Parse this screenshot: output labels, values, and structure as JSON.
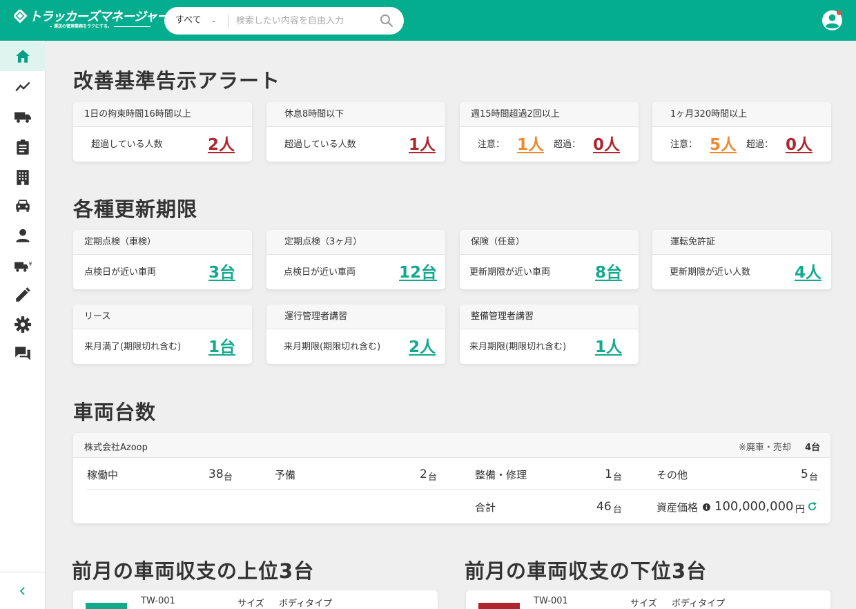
{
  "header": {
    "logo_title": "トラッカーズマネージャー",
    "logo_tagline": "運送の管理業務をラクにする。",
    "search_scope": "すべて",
    "search_placeholder": "検索したい内容を自由入力"
  },
  "sidebar": {
    "items": [
      "home-icon",
      "trend-icon",
      "truck-icon",
      "clipboard-icon",
      "building-icon",
      "car-icon",
      "person-icon",
      "truck-cost-icon",
      "pencil-icon",
      "gear-icon",
      "chat-icon"
    ],
    "collapse": "chevron-left-icon"
  },
  "alerts": {
    "title": "改善基準告示アラート",
    "cards": [
      {
        "head": "1日の拘束時間16時間以上",
        "label": "超過している人数",
        "value": "2人"
      },
      {
        "head": "休息8時間以下",
        "label": "超過している人数",
        "value": "1人"
      },
      {
        "head": "週15時間超過2回以上",
        "warn_label": "注意：",
        "warn_value": "1人",
        "over_label": "超過：",
        "over_value": "0人"
      },
      {
        "head": "1ヶ月320時間以上",
        "warn_label": "注意：",
        "warn_value": "5人",
        "over_label": "超過：",
        "over_value": "0人"
      }
    ]
  },
  "renewals": {
    "title": "各種更新期限",
    "cards": [
      {
        "head": "定期点検（車検）",
        "label": "点検日が近い車両",
        "value": "3台"
      },
      {
        "head": "定期点検（3ヶ月）",
        "label": "点検日が近い車両",
        "value": "12台"
      },
      {
        "head": "保険（任意）",
        "label": "更新期限が近い車両",
        "value": "8台"
      },
      {
        "head": "運転免許証",
        "label": "更新期限が近い人数",
        "value": "4人"
      },
      {
        "head": "リース",
        "label": "来月満了(期限切れ含む)",
        "value": "1台"
      },
      {
        "head": "運行管理者講習",
        "label": "来月期限(期限切れ含む)",
        "value": "2人"
      },
      {
        "head": "整備管理者講習",
        "label": "来月期限(期限切れ含む)",
        "value": "1人"
      }
    ]
  },
  "vehicles": {
    "title": "車両台数",
    "company": "株式会社Azoop",
    "disposed_label": "※廃車・売却",
    "disposed_value": "4台",
    "stats": [
      {
        "label": "稼働中",
        "num": "38",
        "unit": "台"
      },
      {
        "label": "予備",
        "num": "2",
        "unit": "台"
      },
      {
        "label": "整備・修理",
        "num": "1",
        "unit": "台"
      },
      {
        "label": "その他",
        "num": "5",
        "unit": "台"
      }
    ],
    "total_label": "合計",
    "total_num": "46",
    "total_unit": "台",
    "asset_label": "資産価格",
    "asset_value": "100,000,000",
    "asset_unit": "円"
  },
  "ranking": {
    "top_title": "前月の車両収支の上位3台",
    "bottom_title": "前月の車両収支の下位3台",
    "top_first": {
      "id": "TW-001",
      "size_label": "サイズ",
      "body_label": "ボディタイプ"
    },
    "bottom_first": {
      "id": "TW-001",
      "size_label": "サイズ",
      "body_label": "ボディタイプ"
    }
  },
  "colors": {
    "brand": "#05ad8f",
    "alert_red": "#b0262f",
    "warn_orange": "#ee8a2d",
    "link_teal": "#13a98d"
  }
}
